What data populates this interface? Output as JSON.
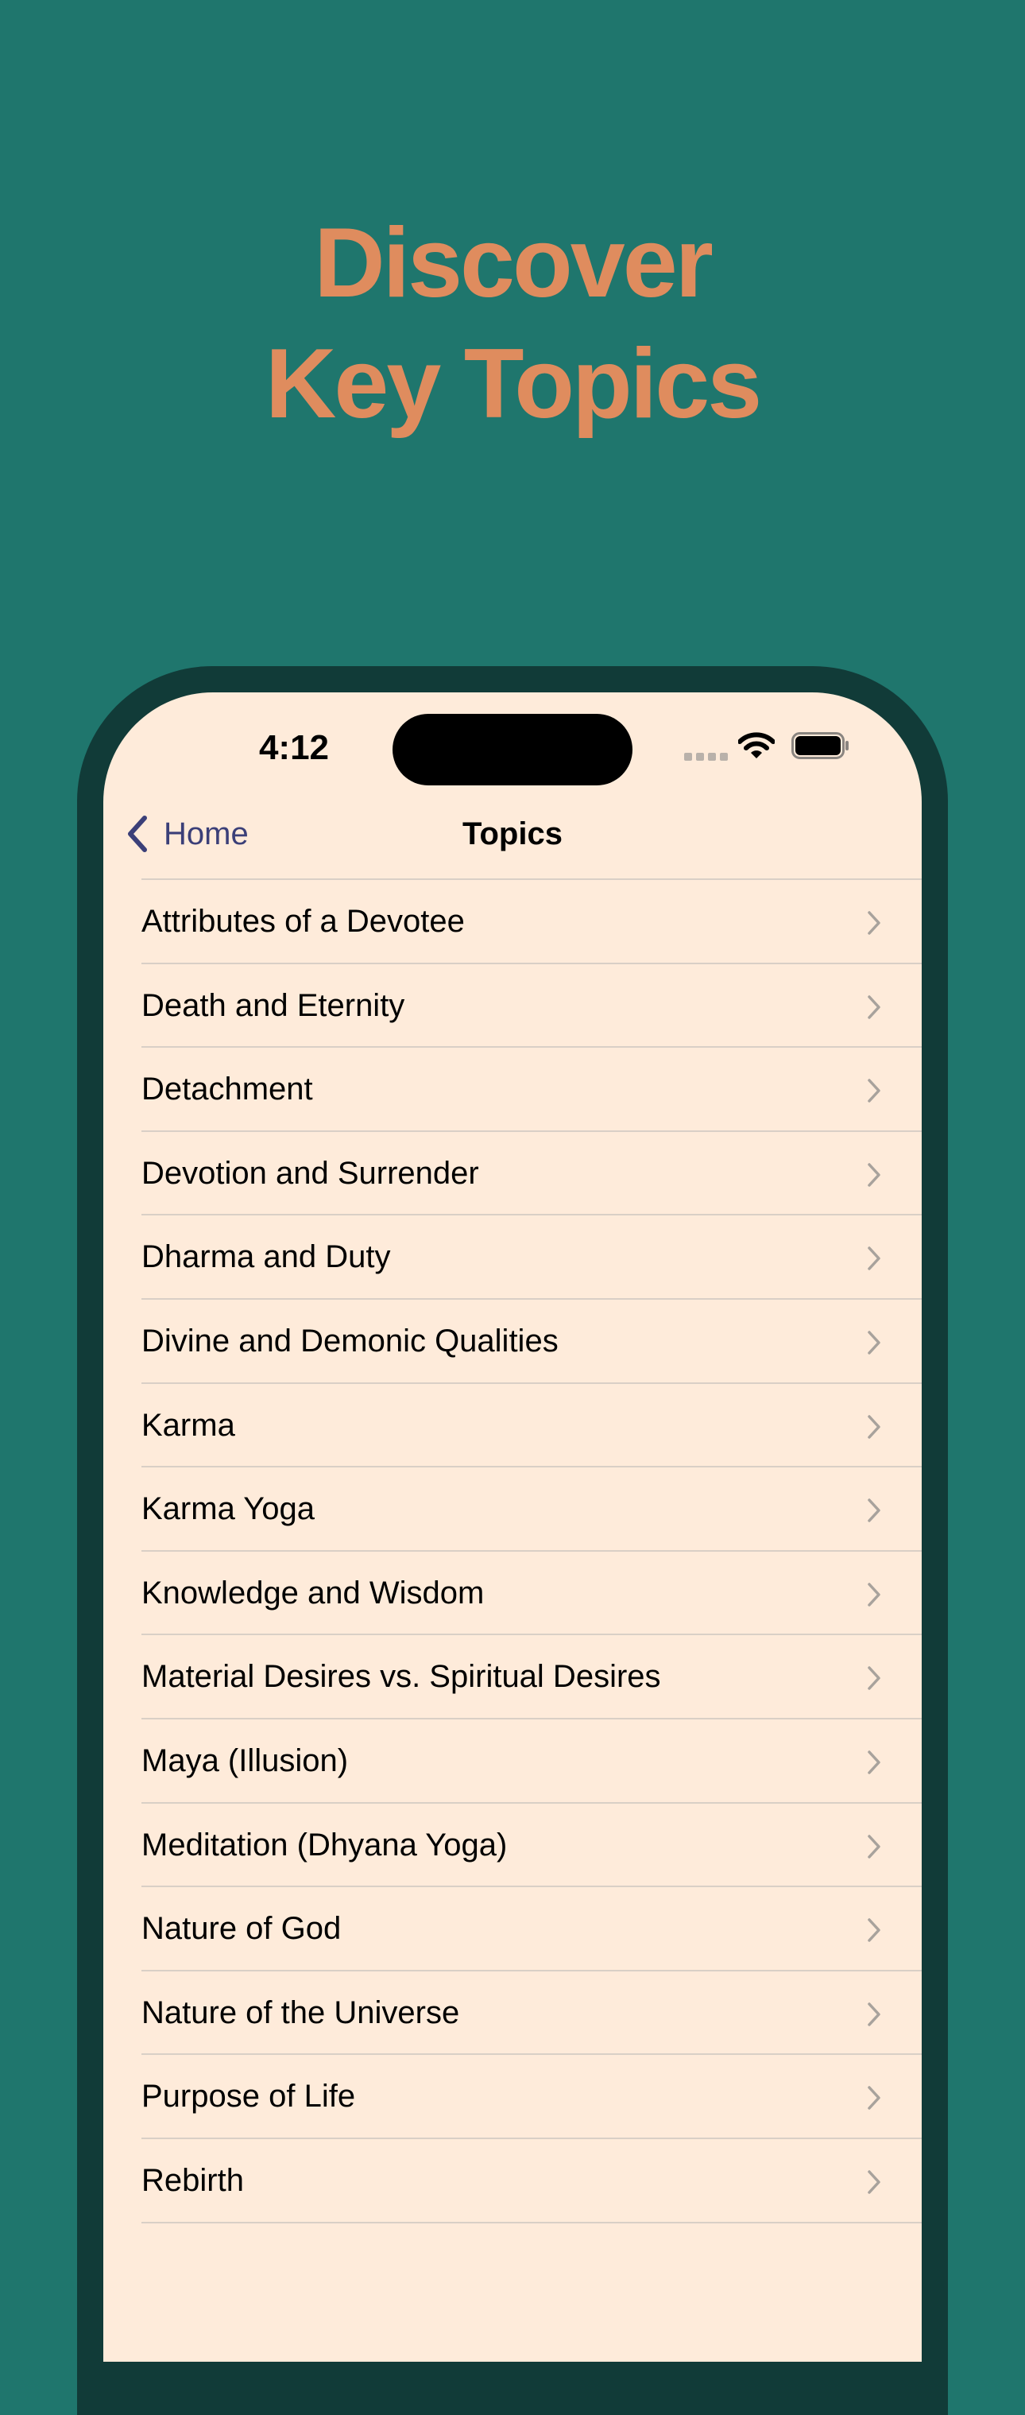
{
  "headline": {
    "line1": "Discover",
    "line2": "Key Topics"
  },
  "status_bar": {
    "time": "4:12"
  },
  "nav": {
    "back_label": "Home",
    "title": "Topics"
  },
  "topics": [
    {
      "label": "Attributes of a Devotee"
    },
    {
      "label": "Death and Eternity"
    },
    {
      "label": "Detachment"
    },
    {
      "label": "Devotion and Surrender"
    },
    {
      "label": "Dharma and Duty"
    },
    {
      "label": "Divine and Demonic Qualities"
    },
    {
      "label": "Karma"
    },
    {
      "label": "Karma Yoga"
    },
    {
      "label": "Knowledge and Wisdom"
    },
    {
      "label": "Material Desires vs. Spiritual Desires"
    },
    {
      "label": "Maya (Illusion)"
    },
    {
      "label": "Meditation (Dhyana Yoga)"
    },
    {
      "label": "Nature of God"
    },
    {
      "label": "Nature of the Universe"
    },
    {
      "label": "Purpose of Life"
    },
    {
      "label": "Rebirth"
    }
  ],
  "colors": {
    "background": "#1f766d",
    "headline": "#df8c5e",
    "phone_frame": "#113b38",
    "screen": "#feebda",
    "back_tint": "#3b3f78"
  },
  "icons": {
    "back": "chevron-left-icon",
    "row": "chevron-right-icon",
    "wifi": "wifi-icon",
    "battery": "battery-icon"
  }
}
